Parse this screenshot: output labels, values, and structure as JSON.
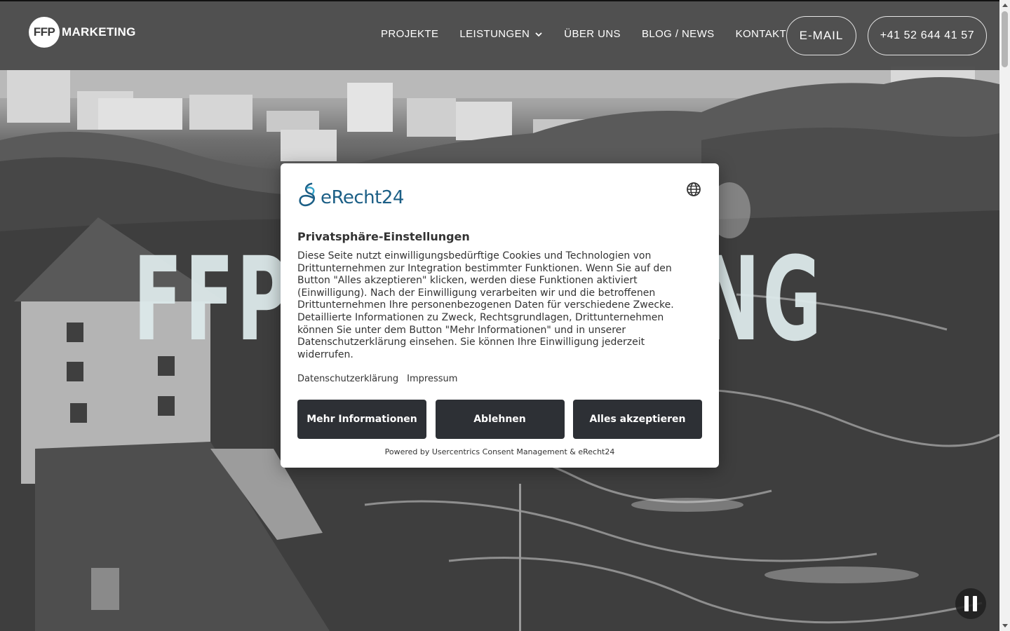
{
  "header": {
    "logo_mark": "FFP",
    "logo_text": "MARKETING",
    "nav": [
      "PROJEKTE",
      "LEISTUNGEN",
      "ÜBER UNS",
      "BLOG / NEWS",
      "KONTAKT"
    ],
    "email_label": "E-MAIL",
    "phone_label": "+41 52 644 41 57"
  },
  "hero": {
    "title": "FFP MARKETING"
  },
  "consent": {
    "brand_name": "eRecht24",
    "title": "Privatsphäre-Einstellungen",
    "body": "Diese Seite nutzt einwilligungsbedürftige Cookies und Technologien von Drittunternehmen zur Integration bestimmter Funktionen. Wenn Sie auf den Button \"Alles akzeptieren\" klicken, werden diese Funktionen aktiviert (Einwilligung). Nach der Einwilligung verarbeiten wir und die betroffenen Drittunternehmen Ihre personenbezogenen Daten für verschiedene Zwecke. Detaillierte Informationen zu Zweck, Rechtsgrundlagen, Drittunternehmen können Sie unter dem Button \"Mehr Informationen\" und in unserer Datenschutzerklärung einsehen. Sie können Ihre Einwilligung jederzeit widerrufen.",
    "link_privacy": "Datenschutzerklärung",
    "link_imprint": "Impressum",
    "btn_more": "Mehr Informationen",
    "btn_decline": "Ablehnen",
    "btn_accept": "Alles akzeptieren",
    "powered_by": "Powered by Usercentrics Consent Management & eRecht24"
  },
  "icons": {
    "language": "globe-icon",
    "nav_dropdown": "chevron-down-icon",
    "video_control": "pause-icon"
  },
  "colors": {
    "header_bg": "#464646",
    "hero_title": "#dde9ea",
    "modal_button": "#2d3035",
    "brand_blue": "#1c5f86"
  }
}
